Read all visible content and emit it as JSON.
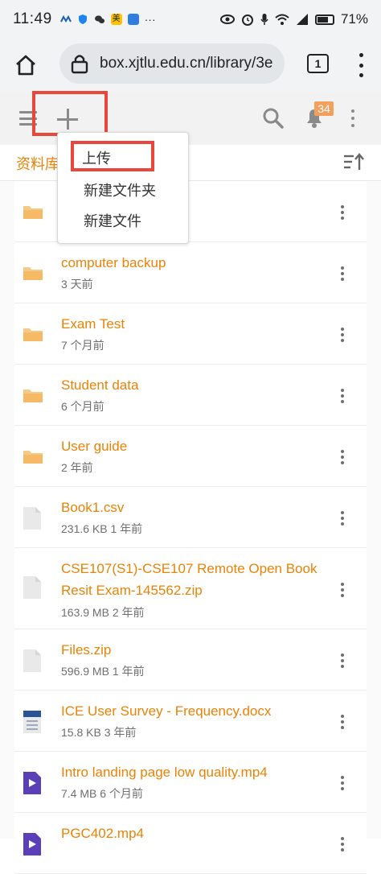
{
  "status": {
    "time": "11:49",
    "battery": "71%",
    "battery_level": 0.71,
    "left_icons": [
      "carrier-icon",
      "shield-icon",
      "wechat-icon",
      "meituan-icon",
      "app-icon",
      "more-icon"
    ],
    "right_icons": [
      "eye-icon",
      "alarm-icon",
      "mic-icon",
      "wifi-icon",
      "signal-icon"
    ]
  },
  "browser": {
    "url": "box.xjtlu.edu.cn/library/3e",
    "tab_count": "1"
  },
  "toolbar": {
    "notification_count": "34"
  },
  "breadcrumb": {
    "text": "资料库"
  },
  "dropdown": {
    "items": [
      "上传",
      "新建文件夹",
      "新建文件"
    ]
  },
  "files": [
    {
      "name": "",
      "meta": "",
      "type": "folder"
    },
    {
      "name": "computer backup",
      "meta": "3 天前",
      "type": "folder"
    },
    {
      "name": "Exam Test",
      "meta": "7 个月前",
      "type": "folder"
    },
    {
      "name": "Student data",
      "meta": "6 个月前",
      "type": "folder"
    },
    {
      "name": "User guide",
      "meta": "2 年前",
      "type": "folder"
    },
    {
      "name": "Book1.csv",
      "meta": "231.6 KB   1 年前",
      "type": "file"
    },
    {
      "name": "CSE107(S1)-CSE107 Remote Open Book Resit Exam-145562.zip",
      "meta": "163.9 MB   2 年前",
      "type": "file"
    },
    {
      "name": "Files.zip",
      "meta": "596.9 MB   1 年前",
      "type": "file"
    },
    {
      "name": "ICE User Survey - Frequency.docx",
      "meta": "15.8 KB   3 年前",
      "type": "doc"
    },
    {
      "name": "Intro landing page low quality.mp4",
      "meta": "7.4 MB   6 个月前",
      "type": "video"
    },
    {
      "name": "PGC402.mp4",
      "meta": "",
      "type": "video"
    }
  ]
}
